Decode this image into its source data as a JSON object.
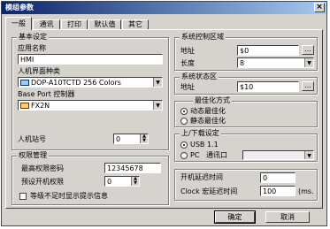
{
  "window": {
    "title": "模组参数",
    "close_glyph": "×"
  },
  "tabs": [
    {
      "label": "一般"
    },
    {
      "label": "通讯"
    },
    {
      "label": "打印"
    },
    {
      "label": "默认值"
    },
    {
      "label": "其它"
    }
  ],
  "basic": {
    "title": "基本设定",
    "app_name_label": "应用名称",
    "app_name_value": "HMI",
    "hmi_type_label": "人机界面种类",
    "hmi_type_value": "DOP-A10TCTD 256 Colors",
    "base_port_label": "Base Port 控制器",
    "base_port_value": "FX2N",
    "station_label": "人机站号",
    "station_value": "0"
  },
  "permission": {
    "title": "权限管理",
    "top_pwd_label": "最高权限密码",
    "top_pwd_value": "12345678",
    "default_level_label": "预设开机权限",
    "default_level_value": "0",
    "hide_msg_label": "等级不足时显示提示信息"
  },
  "sys_control": {
    "title": "系统控制区域",
    "addr_label": "地址",
    "addr_value": "$0",
    "dots": "...",
    "len_label": "长度",
    "len_value": "8"
  },
  "sys_status": {
    "title": "系统状态区",
    "addr_label": "地址",
    "addr_value": "$10",
    "dots": "..."
  },
  "optimize": {
    "title": "最佳化方式",
    "opt1": "动态最佳化",
    "opt2": "静态最佳化"
  },
  "updown": {
    "title": "上/下载设定",
    "usb": "USB 1.1",
    "pc": "PC",
    "port_label": "通讯口"
  },
  "delays": {
    "boot_label": "开机延迟时间",
    "boot_value": "0",
    "clock_label": "Clock 宏延迟时间",
    "clock_value": "100",
    "clock_unit": "(ms."
  },
  "buttons": {
    "ok": "确定",
    "cancel": "取消"
  }
}
